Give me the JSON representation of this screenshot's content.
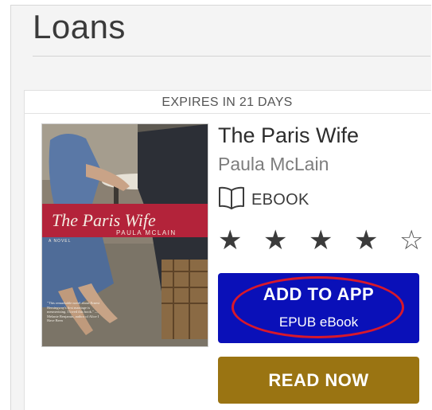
{
  "page": {
    "title": "Loans"
  },
  "loan": {
    "expires_text": "EXPIRES IN 21 DAYS",
    "title": "The Paris Wife",
    "author": "Paula McLain",
    "format": {
      "icon": "open-book-icon",
      "label": "EBOOK"
    },
    "rating": {
      "value": 4,
      "max": 5
    },
    "cover": {
      "title_text": "The Paris Wife",
      "author_text": "PAULA MCLAIN",
      "subtitle_text": "A NOVEL",
      "quote_text": "\"This remarkable novel about Ernest Hemingway's first marriage is mesmerizing. I loved this book.\" —Melanie Benjamin, author of Alice I Have Been"
    },
    "add_button": {
      "label": "ADD TO APP",
      "sublabel": "EPUB eBook"
    },
    "read_button": {
      "label": "READ NOW"
    }
  },
  "colors": {
    "add_button_bg": "#0a10b8",
    "read_button_bg": "#9a7412",
    "highlight_ring": "#d8182b",
    "cover_banner": "#b3233a"
  }
}
